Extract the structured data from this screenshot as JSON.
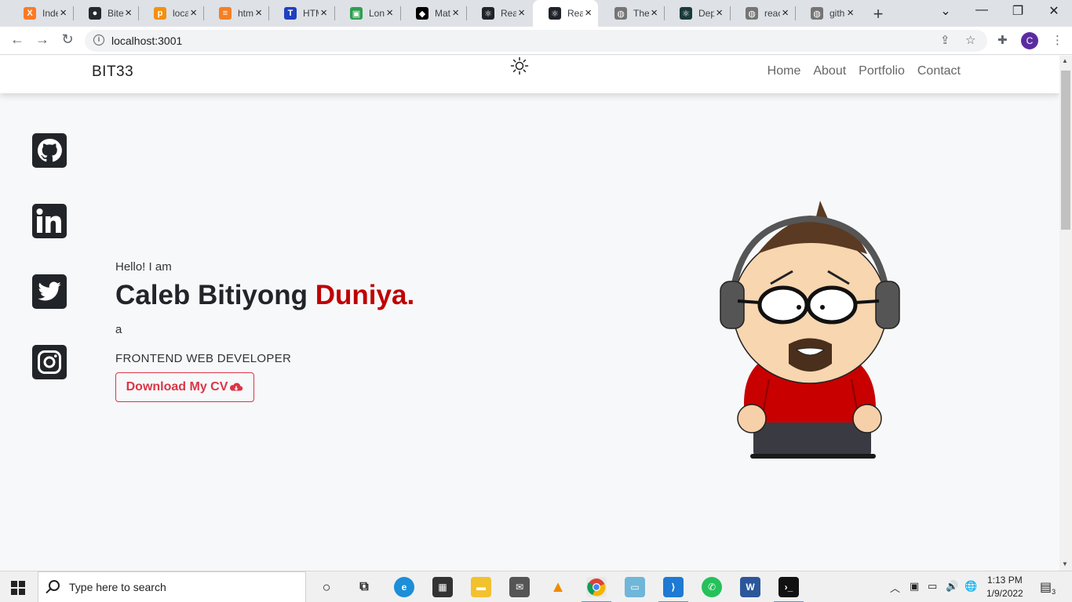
{
  "browser": {
    "tabs": [
      {
        "title": "Index",
        "favicon_color": "#fb7a24",
        "favicon_glyph": "X"
      },
      {
        "title": "Bitey",
        "favicon_color": "#24292e",
        "favicon_glyph": "●"
      },
      {
        "title": "localhost",
        "favicon_color": "#f29111",
        "favicon_glyph": "p"
      },
      {
        "title": "html",
        "favicon_color": "#f48024",
        "favicon_glyph": "≡"
      },
      {
        "title": "HTML",
        "favicon_color": "#1f3fbf",
        "favicon_glyph": "T"
      },
      {
        "title": "Long",
        "favicon_color": "#2e9e4f",
        "favicon_glyph": "▣"
      },
      {
        "title": "Material",
        "favicon_color": "#000000",
        "favicon_glyph": "◆"
      },
      {
        "title": "React",
        "favicon_color": "#20232a",
        "favicon_glyph": "⚛"
      },
      {
        "title": "React",
        "favicon_color": "#20232a",
        "favicon_glyph": "⚛"
      },
      {
        "title": "The",
        "favicon_color": "#757575",
        "favicon_glyph": "◍"
      },
      {
        "title": "Deploy",
        "favicon_color": "#1a3a3a",
        "favicon_glyph": "⚛"
      },
      {
        "title": "react",
        "favicon_color": "#757575",
        "favicon_glyph": "◍"
      },
      {
        "title": "github",
        "favicon_color": "#757575",
        "favicon_glyph": "◍"
      }
    ],
    "active_tab_index": 8,
    "address": "localhost:3001",
    "profile_initial": "C"
  },
  "site": {
    "brand": "BIT33",
    "nav": [
      "Home",
      "About",
      "Portfolio",
      "Contact"
    ],
    "socials": [
      "github-icon",
      "linkedin-icon",
      "twitter-icon",
      "instagram-icon"
    ],
    "hero": {
      "greeting": "Hello! I am",
      "name_first": "Caleb Bitiyong ",
      "name_accent": "Duniya.",
      "a_text": "a",
      "role": "FRONTEND WEB DEVELOPER",
      "cv_button": "Download My CV"
    },
    "accent_color": "#c00000"
  },
  "taskbar": {
    "search_placeholder": "Type here to search",
    "time": "1:13 PM",
    "date": "1/9/2022",
    "notification_count": "3"
  }
}
